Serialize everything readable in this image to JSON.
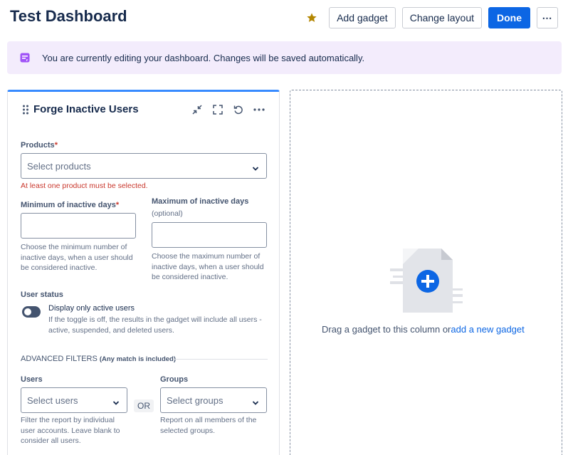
{
  "header": {
    "title": "Test Dashboard",
    "add_gadget": "Add gadget",
    "change_layout": "Change layout",
    "done": "Done",
    "more": "⋯"
  },
  "banner": {
    "text": "You are currently editing your dashboard. Changes will be saved automatically."
  },
  "gadget": {
    "title": "Forge Inactive Users",
    "products": {
      "label": "Products",
      "required": "*",
      "placeholder": "Select products",
      "error": "At least one product must be selected."
    },
    "min_days": {
      "label": "Minimum of inactive days",
      "required": "*",
      "value": "",
      "help": "Choose the minimum number of inactive days, when a user should be considered inactive."
    },
    "max_days": {
      "label": "Maximum of inactive days",
      "optional": "(optional)",
      "value": "",
      "help": "Choose the maximum number of inactive days, when a user should be considered inactive."
    },
    "user_status": {
      "label": "User status",
      "toggle_label": "Display only active users",
      "toggle_on": false,
      "help": "If the toggle is off, the results in the gadget will include all users - active, suspended, and deleted users."
    },
    "advanced": {
      "title": "ADVANCED FILTERS",
      "note": "(Any match is included)"
    },
    "users": {
      "label": "Users",
      "placeholder": "Select users",
      "help": "Filter the report by individual user accounts. Leave blank to consider all users."
    },
    "or_label": "OR",
    "groups": {
      "label": "Groups",
      "placeholder": "Select groups",
      "help": "Report on all members of the selected groups."
    }
  },
  "empty_column": {
    "text": "Drag a gadget to this column or",
    "link": "add a new gadget"
  },
  "colors": {
    "primary": "#0c66e4",
    "star": "#b38600",
    "banner_bg": "#f3ecfc",
    "banner_icon": "#a054f7",
    "error": "#c9372c"
  }
}
